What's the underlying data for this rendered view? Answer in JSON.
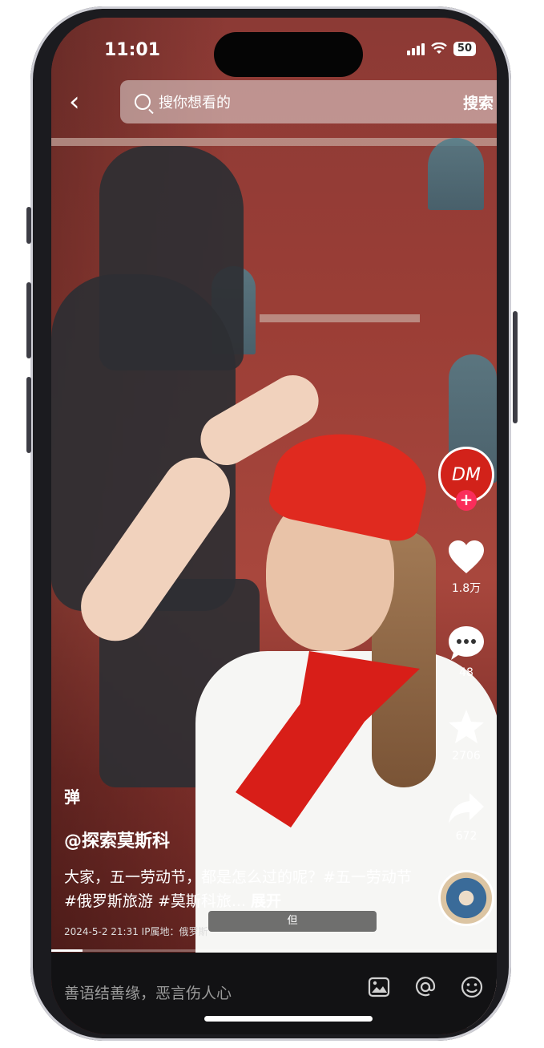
{
  "status_bar": {
    "time": "11:01",
    "battery": "50"
  },
  "search": {
    "back_icon": "chevron-left-icon",
    "placeholder": "搜你想看的",
    "button_label": "搜索"
  },
  "rail": {
    "avatar_text": "DM",
    "follow_icon": "plus-icon",
    "like_count": "1.8万",
    "comment_count": "48",
    "favorite_count": "2706",
    "share_count": "672",
    "music_icon": "music-disc-icon"
  },
  "caption": {
    "small_mark": "弹",
    "author": "@探索莫斯科",
    "description": "大家，五一劳动节，都是怎么过的呢？#五一劳动节 #俄罗斯旅游 #莫斯科旅...",
    "expand_label": "展开",
    "meta": "2024-5-2 21:31  IP属地：俄罗斯"
  },
  "overlay_tag": "但",
  "progress": 0.07,
  "bottom_bar": {
    "comment_placeholder": "善语结善缘，恶言伤人心",
    "icons": [
      "image-icon",
      "at-icon",
      "emoji-icon"
    ]
  },
  "colors": {
    "accent_pink": "#fa2d5b",
    "avatar_red": "#d2221a",
    "bottom_bar_bg": "#121214"
  }
}
